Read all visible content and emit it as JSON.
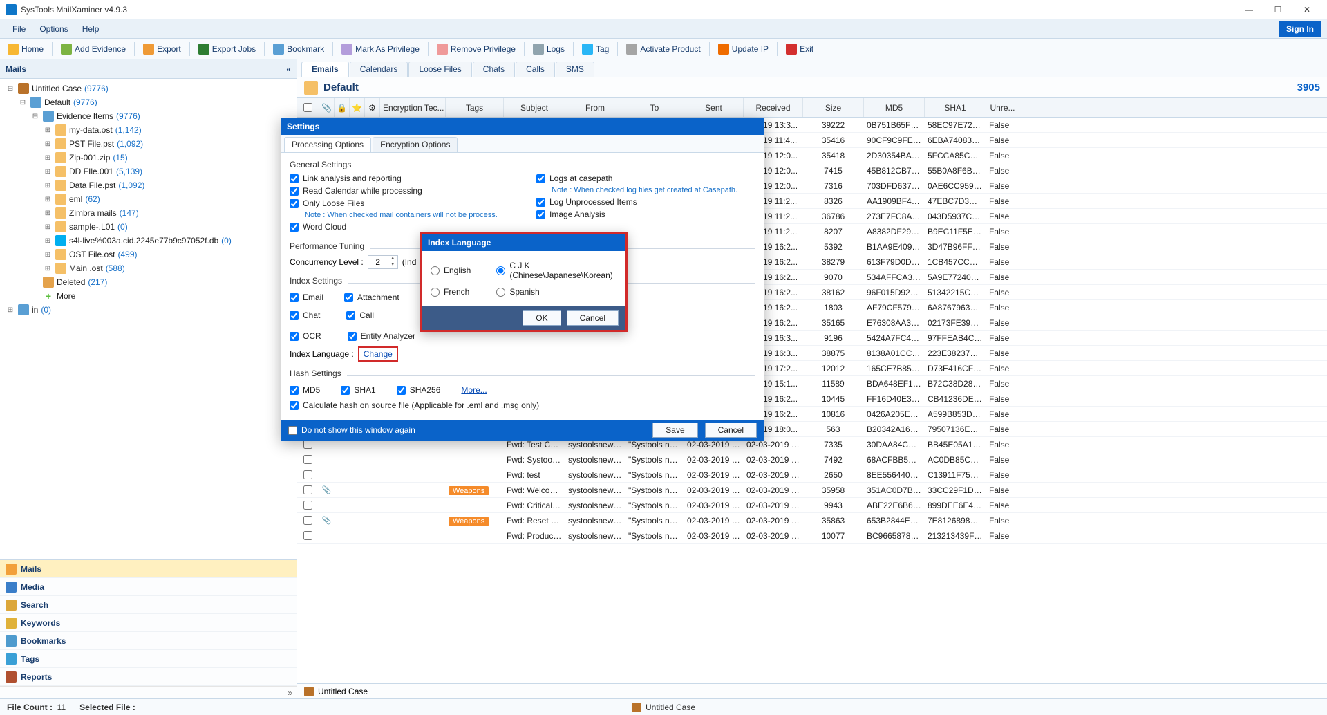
{
  "app": {
    "title": "SysTools MailXaminer v4.9.3"
  },
  "menu": {
    "file": "File",
    "options": "Options",
    "help": "Help",
    "signin": "Sign In"
  },
  "toolbar": {
    "home": "Home",
    "add_evidence": "Add Evidence",
    "export": "Export",
    "export_jobs": "Export Jobs",
    "bookmark": "Bookmark",
    "mark_priv": "Mark As Privilege",
    "remove_priv": "Remove Privilege",
    "logs": "Logs",
    "tag": "Tag",
    "activate": "Activate Product",
    "update_ip": "Update IP",
    "exit": "Exit"
  },
  "left": {
    "header": "Mails",
    "tree": [
      {
        "d": 0,
        "tw": "⊟",
        "ico": "i-case",
        "label": "Untitled Case",
        "count": "(9776)"
      },
      {
        "d": 1,
        "tw": "⊟",
        "ico": "i-user",
        "label": "Default",
        "count": "(9776)"
      },
      {
        "d": 2,
        "tw": "⊟",
        "ico": "i-user",
        "label": "Evidence Items",
        "count": "(9776)"
      },
      {
        "d": 3,
        "tw": "⊞",
        "ico": "i-folder",
        "label": "my-data.ost",
        "count": "(1,142)"
      },
      {
        "d": 3,
        "tw": "⊞",
        "ico": "i-folder",
        "label": "PST File.pst",
        "count": "(1,092)"
      },
      {
        "d": 3,
        "tw": "⊞",
        "ico": "i-folder",
        "label": "Zip-001.zip",
        "count": "(15)"
      },
      {
        "d": 3,
        "tw": "⊞",
        "ico": "i-folder",
        "label": "DD FIle.001",
        "count": "(5,139)"
      },
      {
        "d": 3,
        "tw": "⊞",
        "ico": "i-folder",
        "label": "Data File.pst",
        "count": "(1,092)"
      },
      {
        "d": 3,
        "tw": "⊞",
        "ico": "i-folder",
        "label": "eml",
        "count": "(62)"
      },
      {
        "d": 3,
        "tw": "⊞",
        "ico": "i-folder",
        "label": "Zimbra mails",
        "count": "(147)"
      },
      {
        "d": 3,
        "tw": "⊞",
        "ico": "i-folder",
        "label": "sample-.L01",
        "count": "(0)"
      },
      {
        "d": 3,
        "tw": "⊞",
        "ico": "i-skype",
        "label": "s4l-live%003a.cid.2245e77b9c97052f.db",
        "count": "(0)"
      },
      {
        "d": 3,
        "tw": "⊞",
        "ico": "i-folder",
        "label": "OST File.ost",
        "count": "(499)"
      },
      {
        "d": 3,
        "tw": "⊞",
        "ico": "i-folder",
        "label": "Main .ost",
        "count": "(588)"
      },
      {
        "d": 2,
        "tw": "",
        "ico": "i-deleted",
        "label": "Deleted",
        "count": "(217)"
      },
      {
        "d": 2,
        "tw": "",
        "ico": "i-more",
        "label": "More",
        "count": "",
        "more": true
      },
      {
        "d": 0,
        "tw": "⊞",
        "ico": "i-user",
        "label": "in",
        "count": "(0)"
      }
    ],
    "nav": [
      {
        "ico": "ic-mail",
        "label": "Mails",
        "active": true
      },
      {
        "ico": "ic-media",
        "label": "Media"
      },
      {
        "ico": "ic-search",
        "label": "Search"
      },
      {
        "ico": "ic-key",
        "label": "Keywords"
      },
      {
        "ico": "ic-bm",
        "label": "Bookmarks"
      },
      {
        "ico": "ic-tag",
        "label": "Tags"
      },
      {
        "ico": "ic-rep",
        "label": "Reports"
      }
    ]
  },
  "tabs": {
    "emails": "Emails",
    "calendars": "Calendars",
    "loose": "Loose Files",
    "chats": "Chats",
    "calls": "Calls",
    "sms": "SMS"
  },
  "context": {
    "name": "Default",
    "count": "3905"
  },
  "grid": {
    "headers": {
      "encryption": "Encryption Tec...",
      "tags": "Tags",
      "subject": "Subject",
      "from": "From",
      "to": "To",
      "sent": "Sent",
      "received": "Received",
      "size": "Size",
      "md5": "MD5",
      "sha1": "SHA1",
      "unre": "Unre..."
    },
    "rows": [
      {
        "rec": "2-2019 13:3...",
        "size": "39222",
        "md5": "0B751B65FB4CC...",
        "sha1": "58EC97E72822...",
        "unre": "False"
      },
      {
        "rec": "2-2019 11:4...",
        "size": "35416",
        "md5": "90CF9C9FE278F...",
        "sha1": "6EBA7408364A7...",
        "unre": "False"
      },
      {
        "rec": "2-2019 12:0...",
        "size": "35418",
        "md5": "2D30354BA4AE...",
        "sha1": "5FCCA85C1AA7...",
        "unre": "False"
      },
      {
        "rec": "2-2019 12:0...",
        "size": "7415",
        "md5": "45B812CB77F02...",
        "sha1": "55B0A8F6B2724...",
        "unre": "False"
      },
      {
        "rec": "2-2019 12:0...",
        "size": "7316",
        "md5": "703DFD6377BE...",
        "sha1": "0AE6CC959906...",
        "unre": "False"
      },
      {
        "rec": "2-2019 11:2...",
        "size": "8326",
        "md5": "AA1909BF4182F...",
        "sha1": "47EBC7D3A8F6...",
        "unre": "False"
      },
      {
        "rec": "2-2019 11:2...",
        "size": "36786",
        "md5": "273E7FC8A99C...",
        "sha1": "043D5937C1FF...",
        "unre": "False"
      },
      {
        "rec": "2-2019 11:2...",
        "size": "8207",
        "md5": "A8382DF2910B...",
        "sha1": "B9EC11F5EC55B...",
        "unre": "False"
      },
      {
        "rec": "2-2019 16:2...",
        "size": "5392",
        "md5": "B1AA9E40945FB...",
        "sha1": "3D47B96FF3849...",
        "unre": "False"
      },
      {
        "rec": "2-2019 16:2...",
        "size": "38279",
        "md5": "613F79D0DC8E...",
        "sha1": "1CB457CCCA98...",
        "unre": "False"
      },
      {
        "rec": "2-2019 16:2...",
        "size": "9070",
        "md5": "534AFFCA32F1...",
        "sha1": "5A9E772404FB8...",
        "unre": "False"
      },
      {
        "rec": "2-2019 16:2...",
        "size": "38162",
        "md5": "96F015D9210F3...",
        "sha1": "51342215C4F4C...",
        "unre": "False"
      },
      {
        "rec": "2-2019 16:2...",
        "size": "1803",
        "md5": "AF79CF5790FBF...",
        "sha1": "6A87679635B99...",
        "unre": "False"
      },
      {
        "rec": "2-2019 16:2...",
        "size": "35165",
        "md5": "E76308AA38BE9...",
        "sha1": "02173FE39CF87...",
        "unre": "False"
      },
      {
        "rec": "2-2019 16:3...",
        "size": "9196",
        "md5": "5424A7FC4CE0...",
        "sha1": "97FFEAB4C2769...",
        "unre": "False"
      },
      {
        "rec": "2-2019 16:3...",
        "size": "38875",
        "md5": "8138A01CCF5C...",
        "sha1": "223E382375A7C...",
        "unre": "False"
      },
      {
        "rec": "2-2019 17:2...",
        "size": "12012",
        "md5": "165CE7B852942...",
        "sha1": "D73E416CF956...",
        "unre": "False"
      },
      {
        "rec": "2-2019 15:1...",
        "size": "11589",
        "md5": "BDA648EF1921...",
        "sha1": "B72C38D28967...",
        "unre": "False"
      },
      {
        "rec": "2-2019 16:2...",
        "size": "10445",
        "md5": "FF16D40E3B150...",
        "sha1": "CB41236DEA86...",
        "unre": "False"
      },
      {
        "rec": "2-2019 16:2...",
        "size": "10816",
        "md5": "0426A205EB449...",
        "sha1": "A599B853DBA8...",
        "unre": "False"
      },
      {
        "rec": "2-2019 18:0...",
        "size": "563",
        "md5": "B20342A160356...",
        "sha1": "79507136EF874...",
        "unre": "False"
      },
      {
        "sub": "Fwd: Test Cases...",
        "from": "systoolsnew@...",
        "to": "\"Systools new\" ...",
        "sent": "02-03-2019 09:2...",
        "rec": "02-03-2019 09:2...",
        "size": "7335",
        "md5": "30DAA84CF11B...",
        "sha1": "BB45E05A1ACC...",
        "unre": "False"
      },
      {
        "sub": "Fwd: Systools, ...",
        "from": "systoolsnew@...",
        "to": "\"Systools new\" ...",
        "sent": "02-03-2019 09:2...",
        "rec": "02-03-2019 09:2...",
        "size": "7492",
        "md5": "68ACFBB5AAD4...",
        "sha1": "AC0DB85CBA3D...",
        "unre": "False"
      },
      {
        "sub": "Fwd: test",
        "from": "systoolsnew@...",
        "to": "\"Systools new\" ...",
        "sent": "02-03-2019 09:2...",
        "rec": "02-03-2019 09:2...",
        "size": "2650",
        "md5": "8EE5564403A46...",
        "sha1": "C13911F75DEF...",
        "unre": "False"
      },
      {
        "att": true,
        "tag": "Weapons",
        "sub": "Fwd: Welcome ...",
        "from": "systoolsnew@...",
        "to": "\"Systools new\" ...",
        "sent": "02-03-2019 09:2...",
        "rec": "02-03-2019 09:2...",
        "size": "35958",
        "md5": "351AC0D7B951...",
        "sha1": "33CC29F1D9AF...",
        "unre": "False"
      },
      {
        "sub": "Fwd: Critical se...",
        "from": "systoolsnew@...",
        "to": "\"Systools new\" ...",
        "sent": "02-03-2019 09:2...",
        "rec": "02-03-2019 09:2...",
        "size": "9943",
        "md5": "ABE22E6B66F4F...",
        "sha1": "899DEE6E48184...",
        "unre": "False"
      },
      {
        "att": true,
        "tag": "Weapons",
        "sub": "Fwd: Reset you...",
        "from": "systoolsnew@...",
        "to": "\"Systools new\" ...",
        "sent": "02-03-2019 09:2...",
        "rec": "02-03-2019 09:2...",
        "size": "35863",
        "md5": "653B2844E89FE...",
        "sha1": "7E8126898D12...",
        "unre": "False"
      },
      {
        "sub": "Fwd: Product F...",
        "from": "systoolsnew@...",
        "to": "\"Systools new\" ...",
        "sent": "02-03-2019 09:2...",
        "rec": "02-03-2019 09:2...",
        "size": "10077",
        "md5": "BC966587866F7...",
        "sha1": "213213439FC4B...",
        "unre": "False"
      }
    ]
  },
  "settings": {
    "title": "Settings",
    "tabs": {
      "processing": "Processing Options",
      "encryption": "Encryption Options"
    },
    "general": {
      "header": "General Settings",
      "link_analysis": "Link analysis and reporting",
      "read_calendar": "Read Calendar while processing",
      "only_loose": "Only Loose Files",
      "only_loose_note": "Note : When checked mail containers will not be process.",
      "word_cloud": "Word Cloud",
      "logs_casepath": "Logs at casepath",
      "logs_note": "Note : When checked log files get created at Casepath.",
      "log_unprocessed": "Log Unprocessed Items",
      "image_analysis": "Image Analysis"
    },
    "perf": {
      "header": "Performance Tuning",
      "concurrency_label": "Concurrency Level   :",
      "concurrency_value": "2",
      "suffix": "(Ind"
    },
    "index": {
      "header": "Index Settings",
      "email": "Email",
      "attachment": "Attachment",
      "chat": "Chat",
      "call": "Call",
      "ocr": "OCR",
      "entity": "Entity Analyzer",
      "lang_label": "Index Language   :",
      "change": "Change"
    },
    "hash": {
      "header": "Hash Settings",
      "md5": "MD5",
      "sha1": "SHA1",
      "sha256": "SHA256",
      "more": "More...",
      "calc": "Calculate hash on source file (Applicable for .eml and .msg only)"
    },
    "footer": {
      "dont_show": "Do not show this window again",
      "save": "Save",
      "cancel": "Cancel"
    }
  },
  "lang_dialog": {
    "title": "Index Language",
    "english": "English",
    "cjk": "C J K (Chinese\\Japanese\\Korean)",
    "french": "French",
    "spanish": "Spanish",
    "ok": "OK",
    "cancel": "Cancel"
  },
  "status": {
    "file_count_label": "File Count :",
    "file_count": "11",
    "selected_label": "Selected File :",
    "case": "Untitled Case"
  }
}
